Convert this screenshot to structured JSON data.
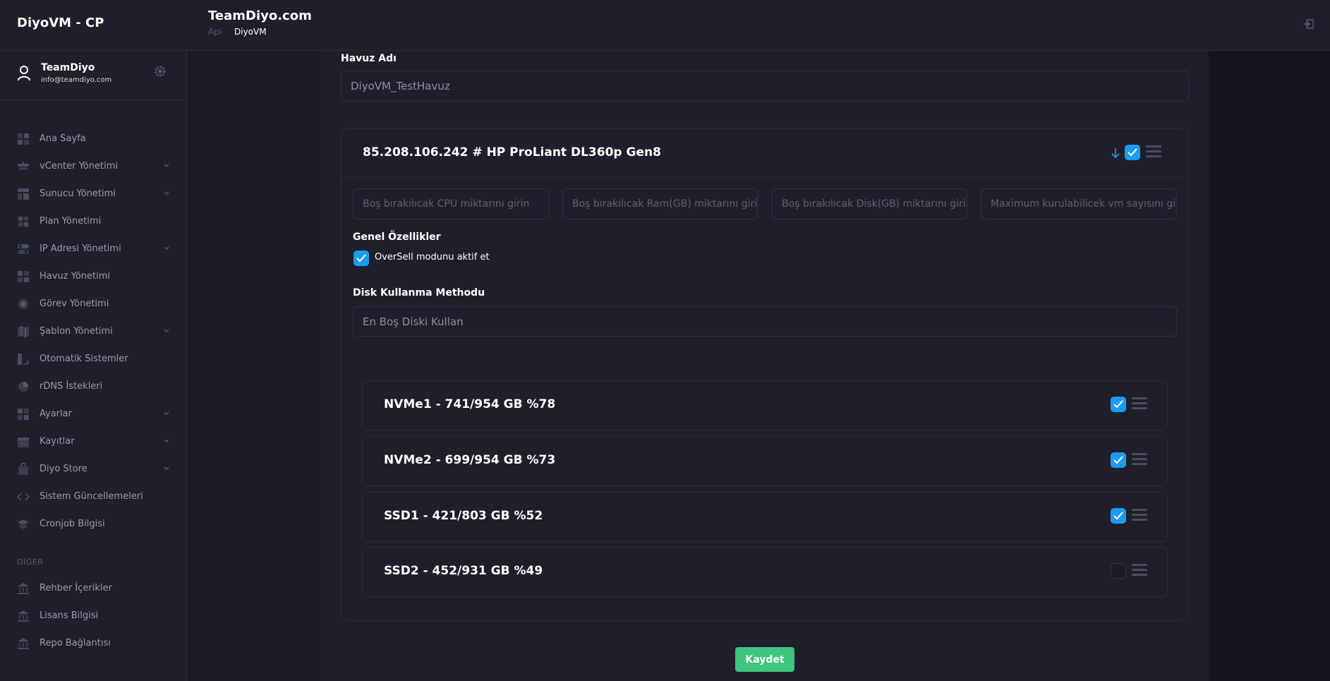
{
  "app": {
    "brand": "DiyoVM - CP",
    "page_title": "TeamDiyo.com",
    "breadcrumb": [
      "Api",
      "DiyoVM"
    ]
  },
  "user": {
    "name": "TeamDiyo",
    "email": "info@teamdiyo.com"
  },
  "sidebar": {
    "items": [
      {
        "label": "Ana Sayfa",
        "icon": "dashboard-icon",
        "has_children": false
      },
      {
        "label": "vCenter Yönetimi",
        "icon": "server-icon",
        "has_children": true
      },
      {
        "label": "Sunucu Yönetimi",
        "icon": "layout-icon",
        "has_children": true
      },
      {
        "label": "Plan Yönetimi",
        "icon": "grid-icon",
        "has_children": false
      },
      {
        "label": "IP Adresi Yönetimi",
        "icon": "toggle-icon",
        "has_children": true
      },
      {
        "label": "Havuz Yönetimi",
        "icon": "grid-icon",
        "has_children": false
      },
      {
        "label": "Görev Yönetimi",
        "icon": "target-icon",
        "has_children": false
      },
      {
        "label": "Şablon Yönetimi",
        "icon": "map-icon",
        "has_children": true
      },
      {
        "label": "Otomatik Sistemler",
        "icon": "automation-icon",
        "has_children": false
      },
      {
        "label": "rDNS İstekleri",
        "icon": "pie-icon",
        "has_children": false
      },
      {
        "label": "Ayarlar",
        "icon": "grid-icon",
        "has_children": true
      },
      {
        "label": "Kayıtlar",
        "icon": "calendar-icon",
        "has_children": true
      },
      {
        "label": "Diyo Store",
        "icon": "bag-icon",
        "has_children": true
      },
      {
        "label": "Sistem Güncellemeleri",
        "icon": "code-icon",
        "has_children": false
      },
      {
        "label": "Cronjob Bilgisi",
        "icon": "graduation-icon",
        "has_children": false
      }
    ],
    "section_label": "DİĞER",
    "other_items": [
      {
        "label": "Rehber İçerikler",
        "icon": "bank-icon"
      },
      {
        "label": "Lisans Bilgisi",
        "icon": "bank-icon"
      },
      {
        "label": "Repo Bağlantısı",
        "icon": "bank-icon"
      }
    ]
  },
  "form": {
    "pool_name_label": "Havuz Adı",
    "pool_name_value": "DiyoVM_TestHavuz",
    "server": {
      "title": "85.208.106.242 # HP ProLiant DL360p Gen8",
      "checked": true,
      "inputs": [
        "Boş bırakılıcak CPU miktarını girin",
        "Boş bırakılıcak Ram(GB) miktarını girin",
        "Boş bırakılıcak Disk(GB) miktarını girin",
        "Maximum kurulabilicek vm sayısını girin"
      ],
      "general_label": "Genel Özellikler",
      "oversell_label": "OverSell modunu aktif et",
      "oversell_checked": true,
      "disk_method_label": "Disk Kullanma Methodu",
      "disk_method_value": "En Boş Diski Kullan",
      "disks": [
        {
          "label": "NVMe1 - 741/954 GB %78",
          "checked": true
        },
        {
          "label": "NVMe2 - 699/954 GB %73",
          "checked": true
        },
        {
          "label": "SSD1 - 421/803 GB %52",
          "checked": true
        },
        {
          "label": "SSD2 - 452/931 GB %49",
          "checked": false
        }
      ]
    },
    "save_label": "Kaydet"
  },
  "colors": {
    "accent": "#1b9cf0",
    "save": "#3ec47e",
    "sidebar_bg": "#1f1f2b",
    "page_bg": "#1b1b25"
  }
}
